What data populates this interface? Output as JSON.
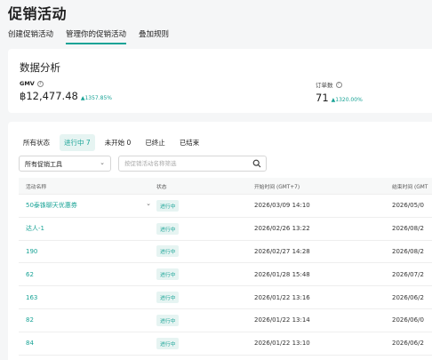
{
  "page_title": "促销活动",
  "tabs": [
    {
      "label": "创建促销活动",
      "active": false
    },
    {
      "label": "管理你的促销活动",
      "active": true
    },
    {
      "label": "叠加规则",
      "active": false
    }
  ],
  "stats": {
    "title": "数据分析",
    "gmv": {
      "label": "GMV",
      "value": "฿12,477.48",
      "delta": "▲1357.85%"
    },
    "orders": {
      "label": "订单数",
      "value": "71",
      "delta": "▲1320.00%"
    }
  },
  "status_filters": [
    {
      "label": "所有状态",
      "active": false
    },
    {
      "label": "进行中 7",
      "active": true
    },
    {
      "label": "未开始 0",
      "active": false
    },
    {
      "label": "已终止",
      "active": false
    },
    {
      "label": "已结束",
      "active": false
    }
  ],
  "tool_select": {
    "value": "所有促销工具"
  },
  "search": {
    "placeholder": "按促销活动名称筛选"
  },
  "table": {
    "headers": [
      "活动名称",
      "状态",
      "开始时间 (GMT+7)",
      "结束时间 (GMT"
    ],
    "rows": [
      {
        "name": "50泰铢聊天优惠券",
        "status": "进行中",
        "start": "2026/03/09 14:10",
        "end": "2026/05/0"
      },
      {
        "name": "达人-1",
        "status": "进行中",
        "start": "2026/02/26 13:22",
        "end": "2026/08/2"
      },
      {
        "name": "190",
        "status": "进行中",
        "start": "2026/02/27 14:28",
        "end": "2026/08/2"
      },
      {
        "name": "62",
        "status": "进行中",
        "start": "2026/01/28 15:48",
        "end": "2026/07/2"
      },
      {
        "name": "163",
        "status": "进行中",
        "start": "2026/01/22 13:16",
        "end": "2026/06/2"
      },
      {
        "name": "82",
        "status": "进行中",
        "start": "2026/01/22 13:14",
        "end": "2026/06/0"
      },
      {
        "name": "84",
        "status": "进行中",
        "start": "2026/01/22 13:10",
        "end": "2026/06/2"
      }
    ]
  },
  "colors": {
    "accent": "#19a396",
    "accent_bg": "#e6f4f2"
  }
}
